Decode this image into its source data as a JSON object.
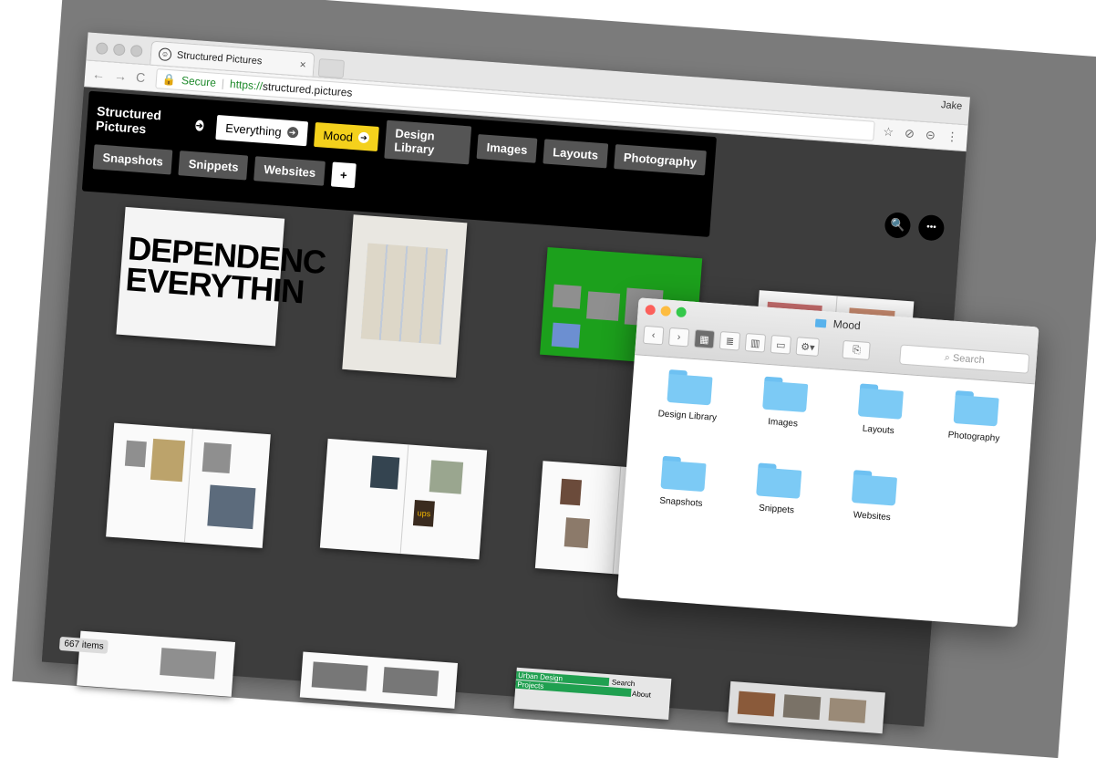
{
  "browser": {
    "tab_title": "Structured Pictures",
    "tab_close": "×",
    "secure_label": "Secure",
    "url_protocol": "https://",
    "url_host": "structured.pictures",
    "user": "Jake"
  },
  "app": {
    "brand": "Structured Pictures",
    "tags_row1": [
      "Everything",
      "Mood",
      "Design Library",
      "Images",
      "Layouts",
      "Photography"
    ],
    "tags_row2": [
      "Snapshots",
      "Snippets",
      "Websites"
    ],
    "plus_label": "+",
    "items_count": "667 items",
    "search_btn": "🔍",
    "more_btn": "•••",
    "poster_line1": "DEPENDENC",
    "poster_line2": "EVERYTHIN",
    "ups_text": "ups",
    "green_nav": {
      "label1": "Urban Design",
      "label2": "Projects",
      "search": "Search",
      "about": "About"
    }
  },
  "finder": {
    "title": "Mood",
    "search_placeholder": "Search",
    "folders": [
      "Design Library",
      "Images",
      "Layouts",
      "Photography",
      "Snapshots",
      "Snippets",
      "Websites"
    ]
  },
  "colors": {
    "yellow_tag": "#f4d11c",
    "app_bg": "#3d3d3d",
    "folder_blue": "#7ccaf5"
  }
}
